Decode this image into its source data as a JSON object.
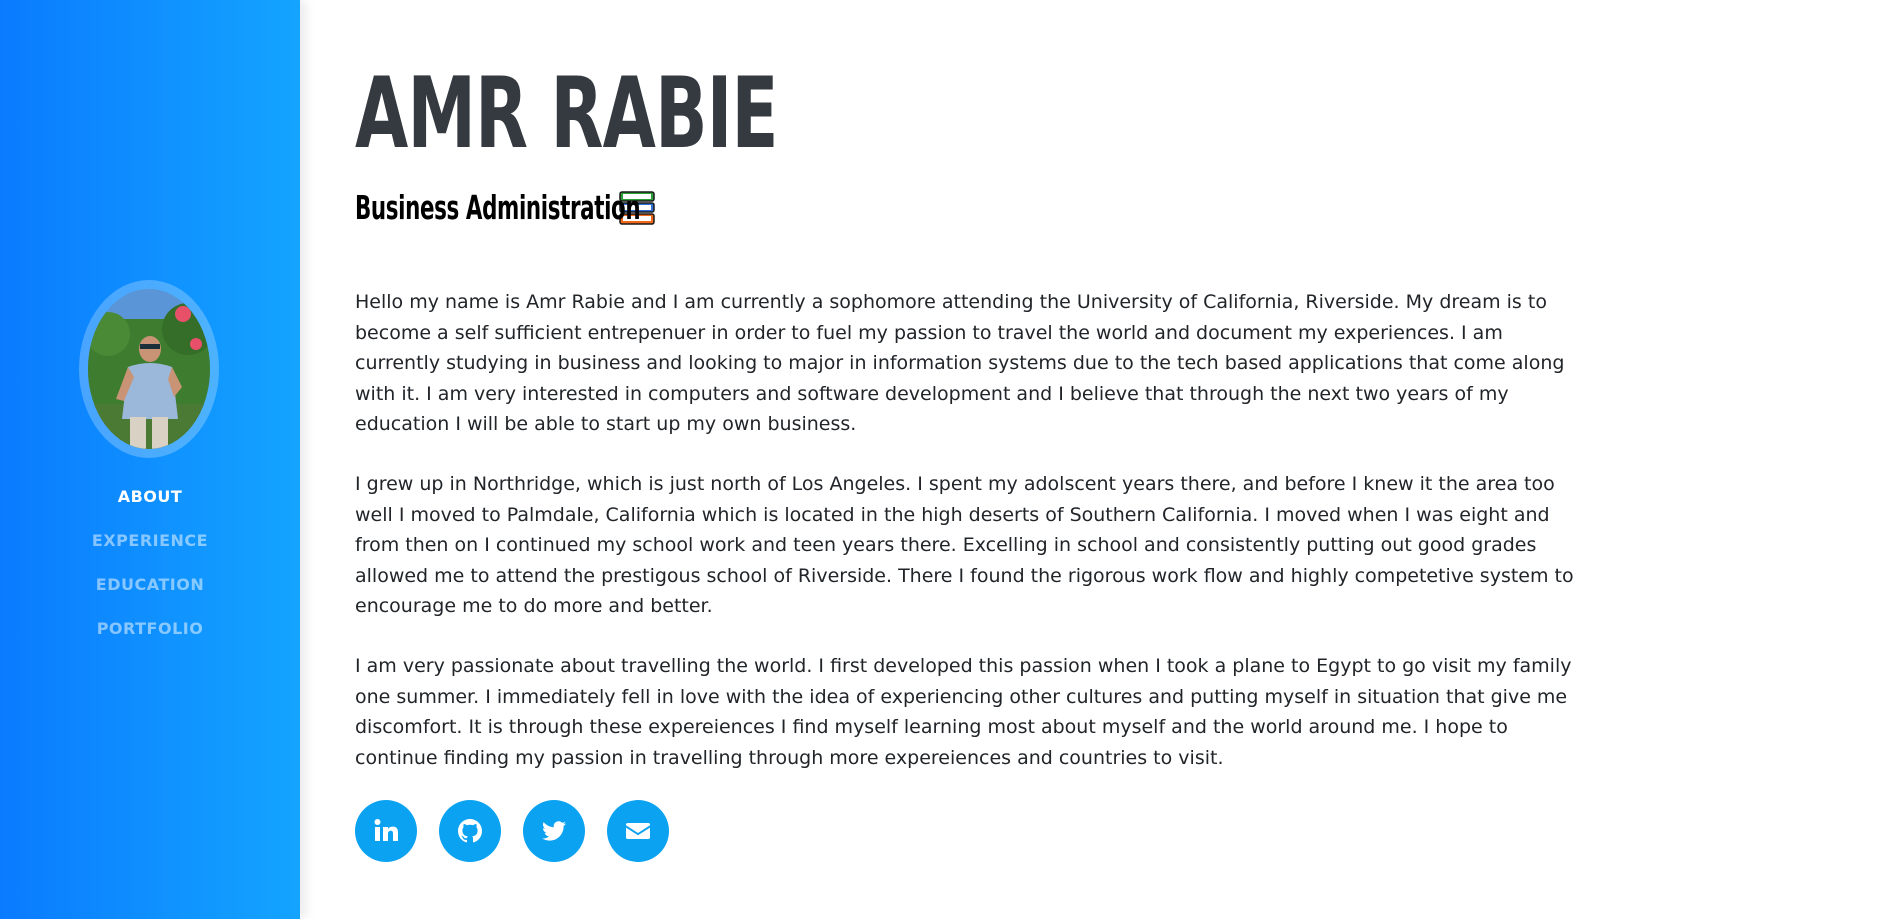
{
  "profile": {
    "name": "AMR RABIE",
    "subtitle": "Business Administration",
    "subtitle_icon": "books-icon",
    "avatar_alt": "profile-photo"
  },
  "nav": {
    "items": [
      {
        "label": "ABOUT",
        "active": true
      },
      {
        "label": "EXPERIENCE",
        "active": false
      },
      {
        "label": "EDUCATION",
        "active": false
      },
      {
        "label": "PORTFOLIO",
        "active": false
      }
    ]
  },
  "about": {
    "paragraphs": [
      "Hello my name is Amr Rabie and I am currently a sophomore attending the University of California, Riverside. My dream is to become a self sufficient entrepenuer in order to fuel my passion to travel the world and document my experiences. I am currently studying in business and looking to major in information systems due to the tech based applications that come along with it. I am very interested in computers and software development and I believe that through the next two years of my education I will be able to start up my own business.",
      "I grew up in Northridge, which is just north of Los Angeles. I spent my adolscent years there, and before I knew it the area too well I moved to Palmdale, California which is located in the high deserts of Southern California. I moved when I was eight and from then on I continued my school work and teen years there. Excelling in school and consistently putting out good grades allowed me to attend the prestigous school of Riverside. There I found the rigorous work flow and highly competetive system to encourage me to do more and better.",
      "I am very passionate about travelling the world. I first developed this passion when I took a plane to Egypt to go visit my family one summer. I immediately fell in love with the idea of experiencing other cultures and putting myself in situation that give me discomfort. It is through these expereiences I find myself learning most about myself and the world around me. I hope to continue finding my passion in travelling through more expereiences and countries to visit."
    ]
  },
  "socials": [
    {
      "icon": "linkedin-icon"
    },
    {
      "icon": "github-icon"
    },
    {
      "icon": "twitter-icon"
    },
    {
      "icon": "email-icon"
    }
  ],
  "colors": {
    "sidebar_start": "#0a7bff",
    "sidebar_end": "#14a4ff",
    "accent": "#0ca2f2",
    "heading": "#343a40",
    "body_text": "#212529"
  }
}
